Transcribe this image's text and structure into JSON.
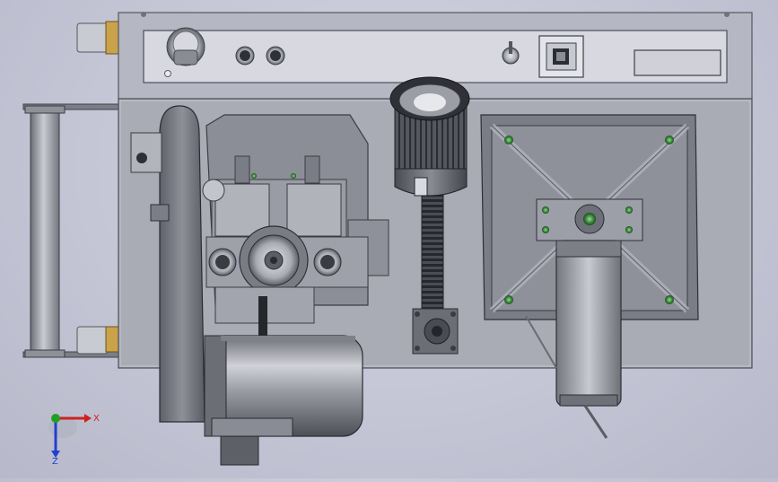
{
  "viewport": {
    "background_color": "#c8cad9",
    "model_components": [
      "control-panel",
      "base-plate",
      "feed-roller-assembly",
      "pulley-belt-guard",
      "gearbox-assembly",
      "electric-motor",
      "lamp-housing",
      "lead-screw",
      "xy-table",
      "stepper-motor"
    ]
  },
  "triad": {
    "x_label": "X",
    "z_label": "Z",
    "x_color": "#d02020",
    "y_color": "#20a020",
    "z_color": "#2040d0"
  }
}
